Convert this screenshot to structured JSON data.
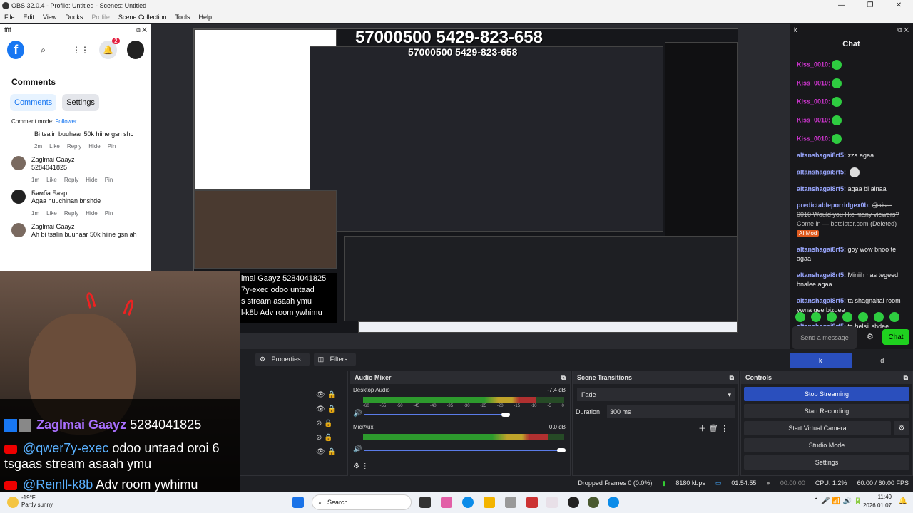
{
  "window": {
    "title": "OBS 32.0.4 - Profile: Untitled - Scenes: Untitled",
    "controls": [
      "—",
      "❐",
      "✕"
    ]
  },
  "menu": [
    "File",
    "Edit",
    "View",
    "Docks",
    "Profile",
    "Scene Collection",
    "Tools",
    "Help"
  ],
  "fb_dock": {
    "title": "ffff",
    "notif_count": "2",
    "heading": "Comments",
    "tabs": [
      "Comments",
      "Settings"
    ],
    "mode_label": "Comment mode:",
    "mode_value": "Follower",
    "comments": [
      {
        "name": "",
        "text": "Bi tsalin buuhaar 50k hiine gsn shc",
        "time": "2m"
      },
      {
        "name": "Zaglmai Gaayz",
        "text": "5284041825",
        "time": "1m"
      },
      {
        "name": "Бямба Баяр",
        "text": "Agaa huuchinan bnshde",
        "time": "1m"
      },
      {
        "name": "Zaglmai Gaayz",
        "text": "Ah bi tsalin buuhaar 50k hiine gsn ah",
        "time": "1m"
      }
    ],
    "actions": [
      "Like",
      "Reply",
      "Hide",
      "Pin"
    ]
  },
  "preview": {
    "headline": "57000500 5429-823-658",
    "overlay_lines": [
      {
        "user": "Zaglmai Gaayz",
        "text": "5284041825"
      },
      {
        "user": "@qwer7y-exec",
        "text": "odoo untaad oroi 6 tsgaas stream asaah ymu"
      },
      {
        "user": "@Reinll-k8b",
        "text": "Adv room ywhimu"
      }
    ],
    "small_overlay": [
      "lmai Gaayz  5284041825",
      "7y-exec  odoo untaad",
      "s stream asaah ymu",
      "l-k8b  Adv room ywhimu"
    ]
  },
  "chat": {
    "dock_title": "k",
    "header": "Chat",
    "kiss_user": "Kiss_0010:",
    "messages": [
      {
        "user": "altanshagai8rt5:",
        "text": "zza agaa"
      },
      {
        "user": "altanshagai8rt5:",
        "text": ""
      },
      {
        "user": "altanshagai8rt5:",
        "text": "agaa bi alnaa"
      },
      {
        "user": "predictableporridgex0b:",
        "text": "@kiss-0010 Would you like many viewers? Come in — botsister.com",
        "deleted": "(Deleted)",
        "tag": "AI Mod"
      },
      {
        "user": "altanshagai8rt5:",
        "text": "goy wow bnoo te agaa"
      },
      {
        "user": "altanshagai8rt5:",
        "text": "Miniih has tegeed bnalee agaa"
      },
      {
        "user": "altanshagai8rt5:",
        "text": "ta shagnaltai room ywna gee bizdee"
      },
      {
        "user": "altanshagai8rt5:",
        "text": "ta helsii shdee"
      }
    ],
    "input_placeholder": "Send a message",
    "send_label": "Chat",
    "tabs": [
      "k",
      "d"
    ]
  },
  "tabs_row": {
    "properties": "Properties",
    "filters": "Filters"
  },
  "audio_mixer": {
    "title": "Audio Mixer",
    "channels": [
      {
        "name": "Desktop Audio",
        "db": "-7.4 dB",
        "level": 0.86
      },
      {
        "name": "Mic/Aux",
        "db": "0.0 dB",
        "level": 0.92
      }
    ],
    "ticks": [
      "-60",
      "-55",
      "-50",
      "-45",
      "-40",
      "-35",
      "-30",
      "-25",
      "-20",
      "-15",
      "-10",
      "-5",
      "0"
    ]
  },
  "transitions": {
    "title": "Scene Transitions",
    "selected": "Fade",
    "duration_label": "Duration",
    "duration": "300 ms"
  },
  "controls": {
    "title": "Controls",
    "buttons": [
      "Stop Streaming",
      "Start Recording",
      "Start Virtual Camera",
      "Studio Mode",
      "Settings"
    ]
  },
  "status": {
    "dropped": "Dropped Frames 0 (0.0%)",
    "kbps": "8180 kbps",
    "stream_time": "01:54:55",
    "rec_time": "00:00:00",
    "cpu": "CPU: 1.2%",
    "fps": "60.00 / 60.00 FPS"
  },
  "taskbar": {
    "weather_temp": "-19°F",
    "weather_desc": "Partly sunny",
    "search": "Search",
    "time": "11:40",
    "date": "2026.01.07"
  },
  "colors": {
    "accent": "#2a4fbd",
    "fb_blue": "#1877f2",
    "twitch_green": "#1fd11f",
    "live_red": "#e22222"
  }
}
